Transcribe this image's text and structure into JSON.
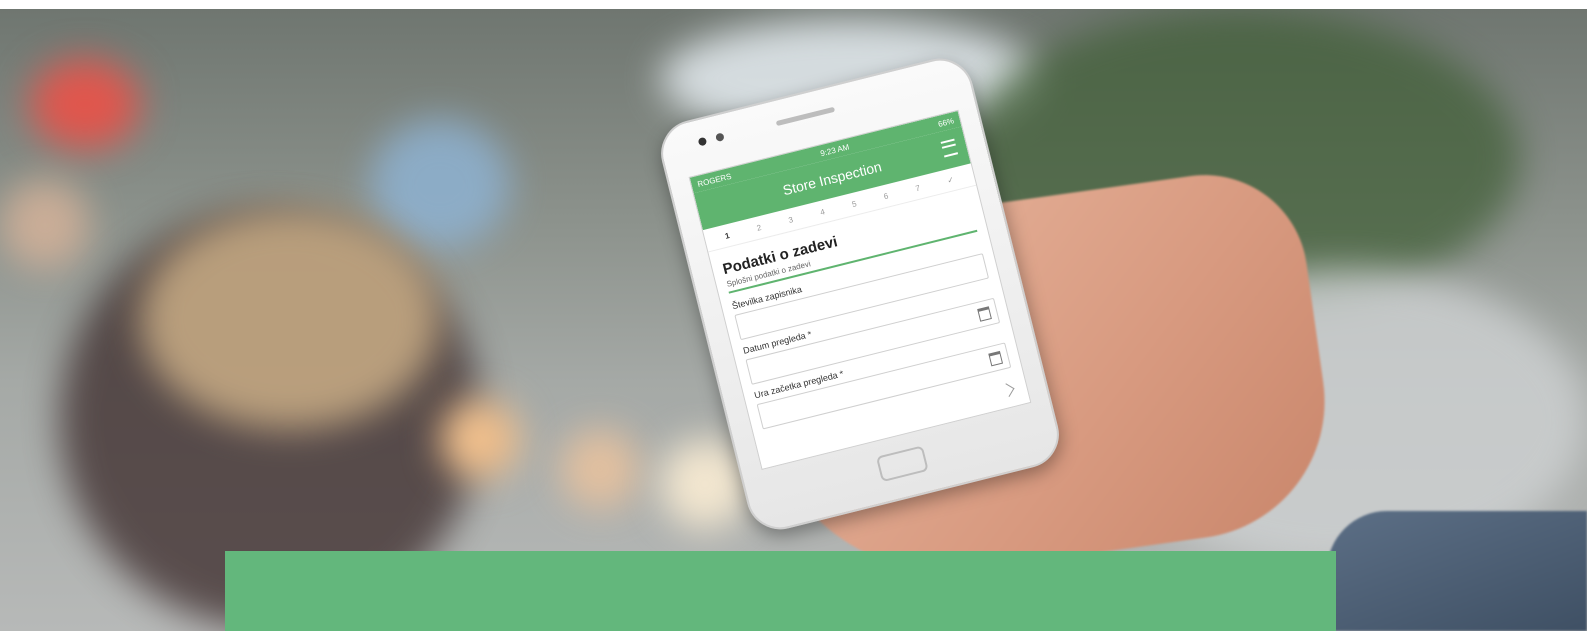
{
  "app": {
    "status_carrier": "ROGERS",
    "status_time": "9:23 AM",
    "status_battery": "66%",
    "title": "Store Inspection",
    "steps": [
      "1",
      "2",
      "3",
      "4",
      "5",
      "6",
      "7",
      "✓"
    ],
    "active_step_index": 0,
    "section_title": "Podatki o zadevi",
    "section_subtitle": "Splošni podatki o zadevi",
    "fields": [
      {
        "label": "Številka zapisnika",
        "has_calendar": false
      },
      {
        "label": "Datum pregleda *",
        "has_calendar": true
      },
      {
        "label": "Ura začetka pregleda *",
        "has_calendar": true
      }
    ]
  },
  "colors": {
    "brand_green": "#5fb46f",
    "banner_green": "#63b77c"
  },
  "icons": [
    "menu-icon",
    "calendar-icon",
    "next-icon",
    "home-button"
  ]
}
